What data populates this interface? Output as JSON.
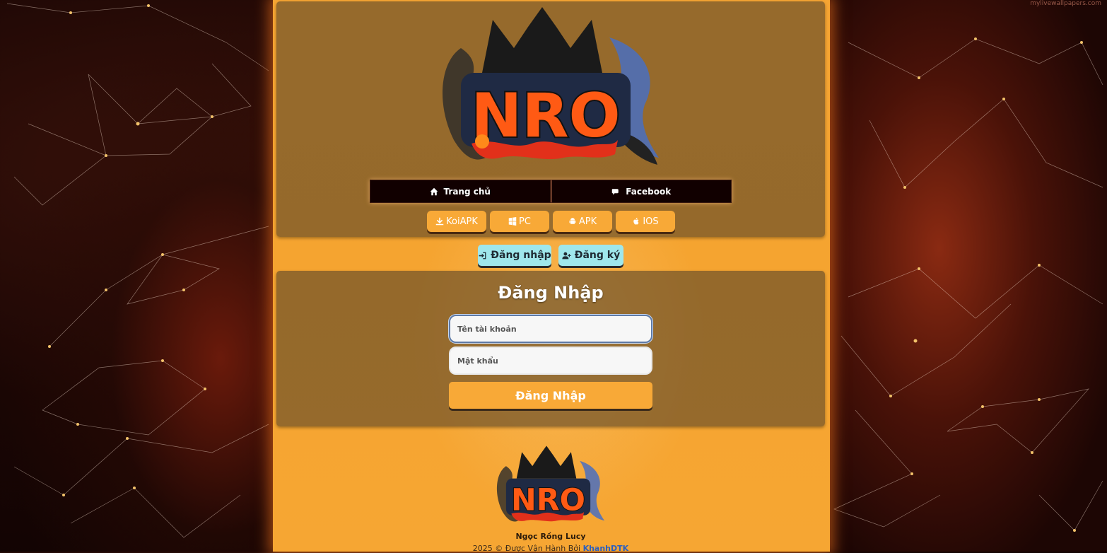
{
  "background": {
    "watermark": "mylivewallpapers.com",
    "accent": "#f6a533"
  },
  "header": {
    "logo_text": "NRO",
    "nav": [
      {
        "label": "Trang chủ",
        "icon": "home-icon"
      },
      {
        "label": "Facebook",
        "icon": "comments-icon"
      }
    ],
    "downloads": [
      {
        "label": "KoiAPK",
        "icon": "download-icon"
      },
      {
        "label": "PC",
        "icon": "windows-icon"
      },
      {
        "label": "APK",
        "icon": "android-icon"
      },
      {
        "label": "IOS",
        "icon": "apple-icon"
      }
    ]
  },
  "auth_tabs": {
    "login": "Đăng nhập",
    "register": "Đăng ký",
    "colors": {
      "tab": "#9fe7ec"
    }
  },
  "login_form": {
    "title": "Đăng Nhập",
    "username_placeholder": "Tên tài khoản",
    "password_placeholder": "Mật khẩu",
    "submit_label": "Đăng Nhập"
  },
  "footer": {
    "logo_text": "NRO",
    "name": "Ngọc Rồng Lucy",
    "copyright_prefix": "2025 © Được Vận Hành Bởi",
    "operator": "KhanhDTK"
  }
}
